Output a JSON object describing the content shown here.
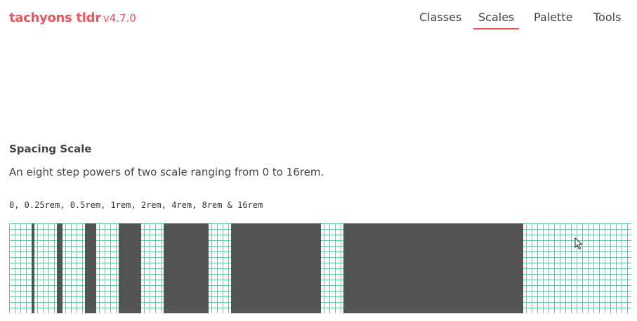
{
  "header": {
    "brand_name": "tachyons tldr",
    "brand_version": "v4.7.0",
    "brand_color": "#e8565d"
  },
  "nav": {
    "items": [
      {
        "label": "Classes",
        "active": false
      },
      {
        "label": "Scales",
        "active": true
      },
      {
        "label": "Palette",
        "active": false
      },
      {
        "label": "Tools",
        "active": false
      }
    ],
    "active_color": "#e8565d"
  },
  "section": {
    "title": "Spacing Scale",
    "description": "An eight step powers of two scale ranging from 0 to 16rem.",
    "values_text": "0, 0.25rem, 0.5rem, 1rem, 2rem, 4rem, 8rem & 16rem"
  },
  "visualization": {
    "grid_color": "#5cc6b0",
    "bar_color": "#555555",
    "steps_rem": [
      0.25,
      0.5,
      1,
      2,
      4,
      8,
      16
    ]
  }
}
